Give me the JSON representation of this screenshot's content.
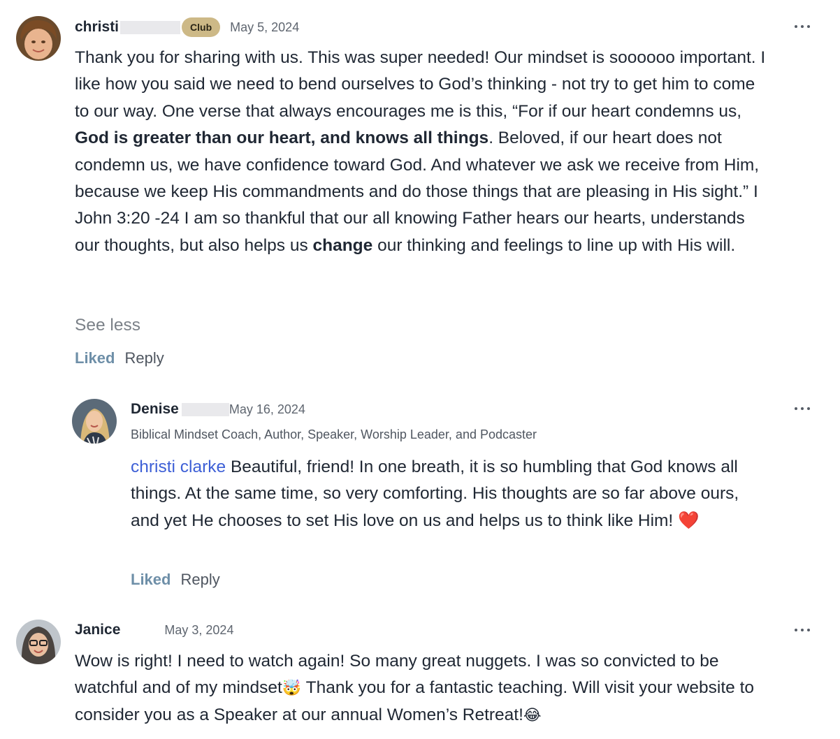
{
  "comments": [
    {
      "author": "christi",
      "badge": "Club",
      "date": "May 5, 2024",
      "body": {
        "p1": "Thank you for sharing with us.  This was super needed!  Our mindset is soooooo important.  I like how you said we need to bend ourselves to God’s thinking - not try to get him to come to our way.  One verse that always encourages me is this, “For if our heart condemns us, ",
        "b1": "God is greater than our heart, and knows all things",
        "p2": ". Beloved, if our heart does not condemn us, we have confidence toward God. And whatever we ask we receive from Him, because we keep His commandments and do those things that are pleasing in His sight.” I John 3:20 -24  I am so thankful that our all knowing Father hears our hearts, understands our thoughts, but also helps us ",
        "b2": "change",
        "p3": " our thinking and feelings to line up with His will."
      },
      "see_less": "See less",
      "liked": "Liked",
      "reply": "Reply",
      "more_icon": "more-horizontal-icon"
    },
    {
      "author": "Denise",
      "date": "May 16, 2024",
      "subtitle": "Biblical Mindset Coach, Author, Speaker, Worship Leader, and Podcaster",
      "mention": "christi clarke",
      "body": " Beautiful, friend! In one breath, it is so humbling that God knows all things. At the same time, so very comforting. His thoughts are so far above ours, and yet He chooses to set His love on us and helps us to think like Him! ",
      "emoji": "❤️",
      "liked": "Liked",
      "reply": "Reply",
      "more_icon": "more-horizontal-icon"
    },
    {
      "author": "Janice",
      "date": "May 3, 2024",
      "body1": "Wow is right! I need to watch again! So many great nuggets. I was so convicted to be watchful and of my mindset",
      "emoji1": "🤯",
      "body2": " Thank you for a fantastic teaching. Will visit your website to consider you as a Speaker at our annual Women’s Retreat!",
      "emoji2": "😂",
      "more_icon": "more-horizontal-icon"
    }
  ],
  "colors": {
    "badge": "#cdb987",
    "mention": "#3d5fd6",
    "liked": "#6e8fa8",
    "text": "#1f2733"
  }
}
